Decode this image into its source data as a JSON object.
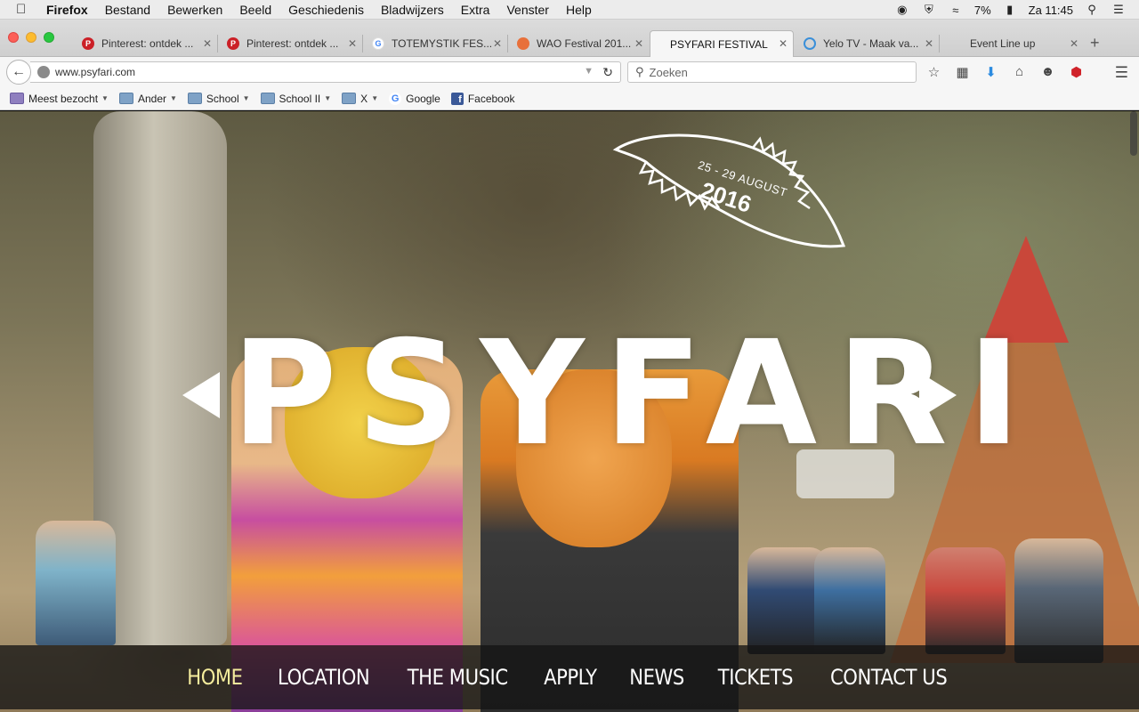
{
  "menubar": {
    "items": [
      "Firefox",
      "Bestand",
      "Bewerken",
      "Beeld",
      "Geschiedenis",
      "Bladwijzers",
      "Extra",
      "Venster",
      "Help"
    ],
    "battery": "7%",
    "clock": "Za 11:45"
  },
  "tabs": [
    {
      "label": "Pinterest: ontdek ...",
      "favicon": "pinterest-icon",
      "color": "#cb2027"
    },
    {
      "label": "Pinterest: ontdek ...",
      "favicon": "pinterest-icon",
      "color": "#cb2027"
    },
    {
      "label": "TOTEMYSTIK FES...",
      "favicon": "google-icon",
      "color": "#4285f4"
    },
    {
      "label": "WAO Festival 201...",
      "favicon": "wao-icon",
      "color": "#e8703a"
    },
    {
      "label": "PSYFARI FESTIVAL",
      "favicon": "none",
      "color": "#f6f6f6"
    },
    {
      "label": "Yelo TV - Maak va...",
      "favicon": "loading-icon",
      "color": "#3a8fd9"
    },
    {
      "label": "Event Line up",
      "favicon": "none",
      "color": "#cfcfcf"
    }
  ],
  "active_tab_index": 4,
  "nav": {
    "url": "www.psyfari.com",
    "search_placeholder": "Zoeken"
  },
  "bookmarks": [
    {
      "label": "Meest bezocht",
      "type": "smart-folder"
    },
    {
      "label": "Ander",
      "type": "folder"
    },
    {
      "label": "School",
      "type": "folder"
    },
    {
      "label": "School II",
      "type": "folder"
    },
    {
      "label": "X",
      "type": "folder"
    },
    {
      "label": "Google",
      "type": "google"
    },
    {
      "label": "Facebook",
      "type": "facebook"
    }
  ],
  "site": {
    "logo_text": "PSYFARI",
    "date_range": "25 - 29 AUGUST",
    "year": "2016",
    "nav": [
      "HOME",
      "LOCATION",
      "THE MUSIC",
      "APPLY",
      "NEWS",
      "TICKETS",
      "CONTACT US"
    ],
    "active_nav_index": 0,
    "accent_color": "#f4ec9c"
  }
}
